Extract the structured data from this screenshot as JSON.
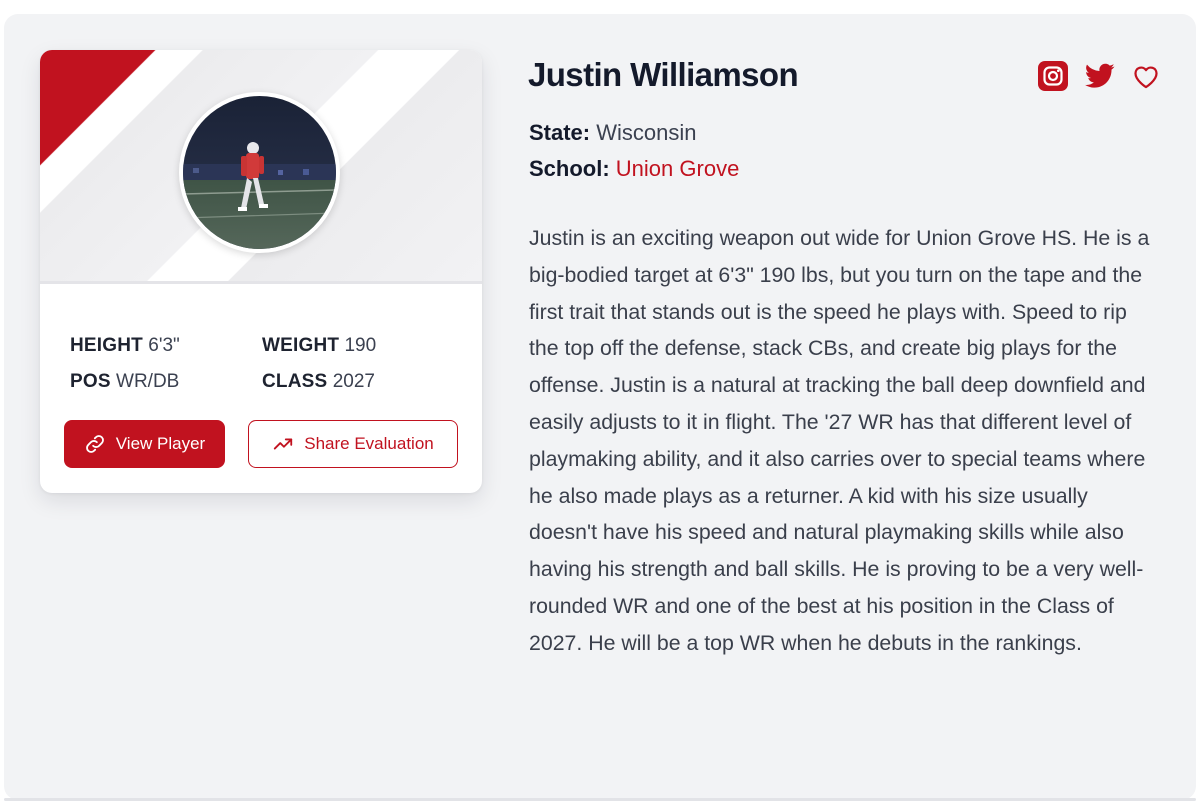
{
  "player": {
    "name": "Justin Williamson",
    "state_label": "State:",
    "state_value": "Wisconsin",
    "school_label": "School:",
    "school_value": "Union Grove"
  },
  "stats": {
    "height_label": "HEIGHT",
    "height_value": "6'3\"",
    "weight_label": "WEIGHT",
    "weight_value": "190",
    "pos_label": "POS",
    "pos_value": "WR/DB",
    "class_label": "CLASS",
    "class_value": "2027"
  },
  "buttons": {
    "view_player": "View Player",
    "share_evaluation": "Share Evaluation"
  },
  "social_icons": [
    "instagram-icon",
    "twitter-icon",
    "heart-icon"
  ],
  "bio": "Justin is an exciting weapon out wide for Union Grove HS. He is a big-bodied target at 6'3\" 190 lbs, but you turn on the tape and the first trait that stands out is the speed he plays with. Speed to rip the top off the defense, stack CBs, and create big plays for the offense. Justin is a natural at tracking the ball deep downfield and easily adjusts to it in flight. The '27 WR has that different level of playmaking ability, and it also carries over to special teams where he also made plays as a returner. A kid with his size usually doesn't have his speed and natural playmaking skills while also having his strength and ball skills. He is proving to be a very well-rounded WR and one of the best at his position in the Class of 2027. He will be a top WR when he debuts in the rankings.",
  "colors": {
    "accent": "#c1121f",
    "panel_bg": "#f2f3f5",
    "heading": "#141a2b",
    "body_text": "#3a3f4b"
  }
}
